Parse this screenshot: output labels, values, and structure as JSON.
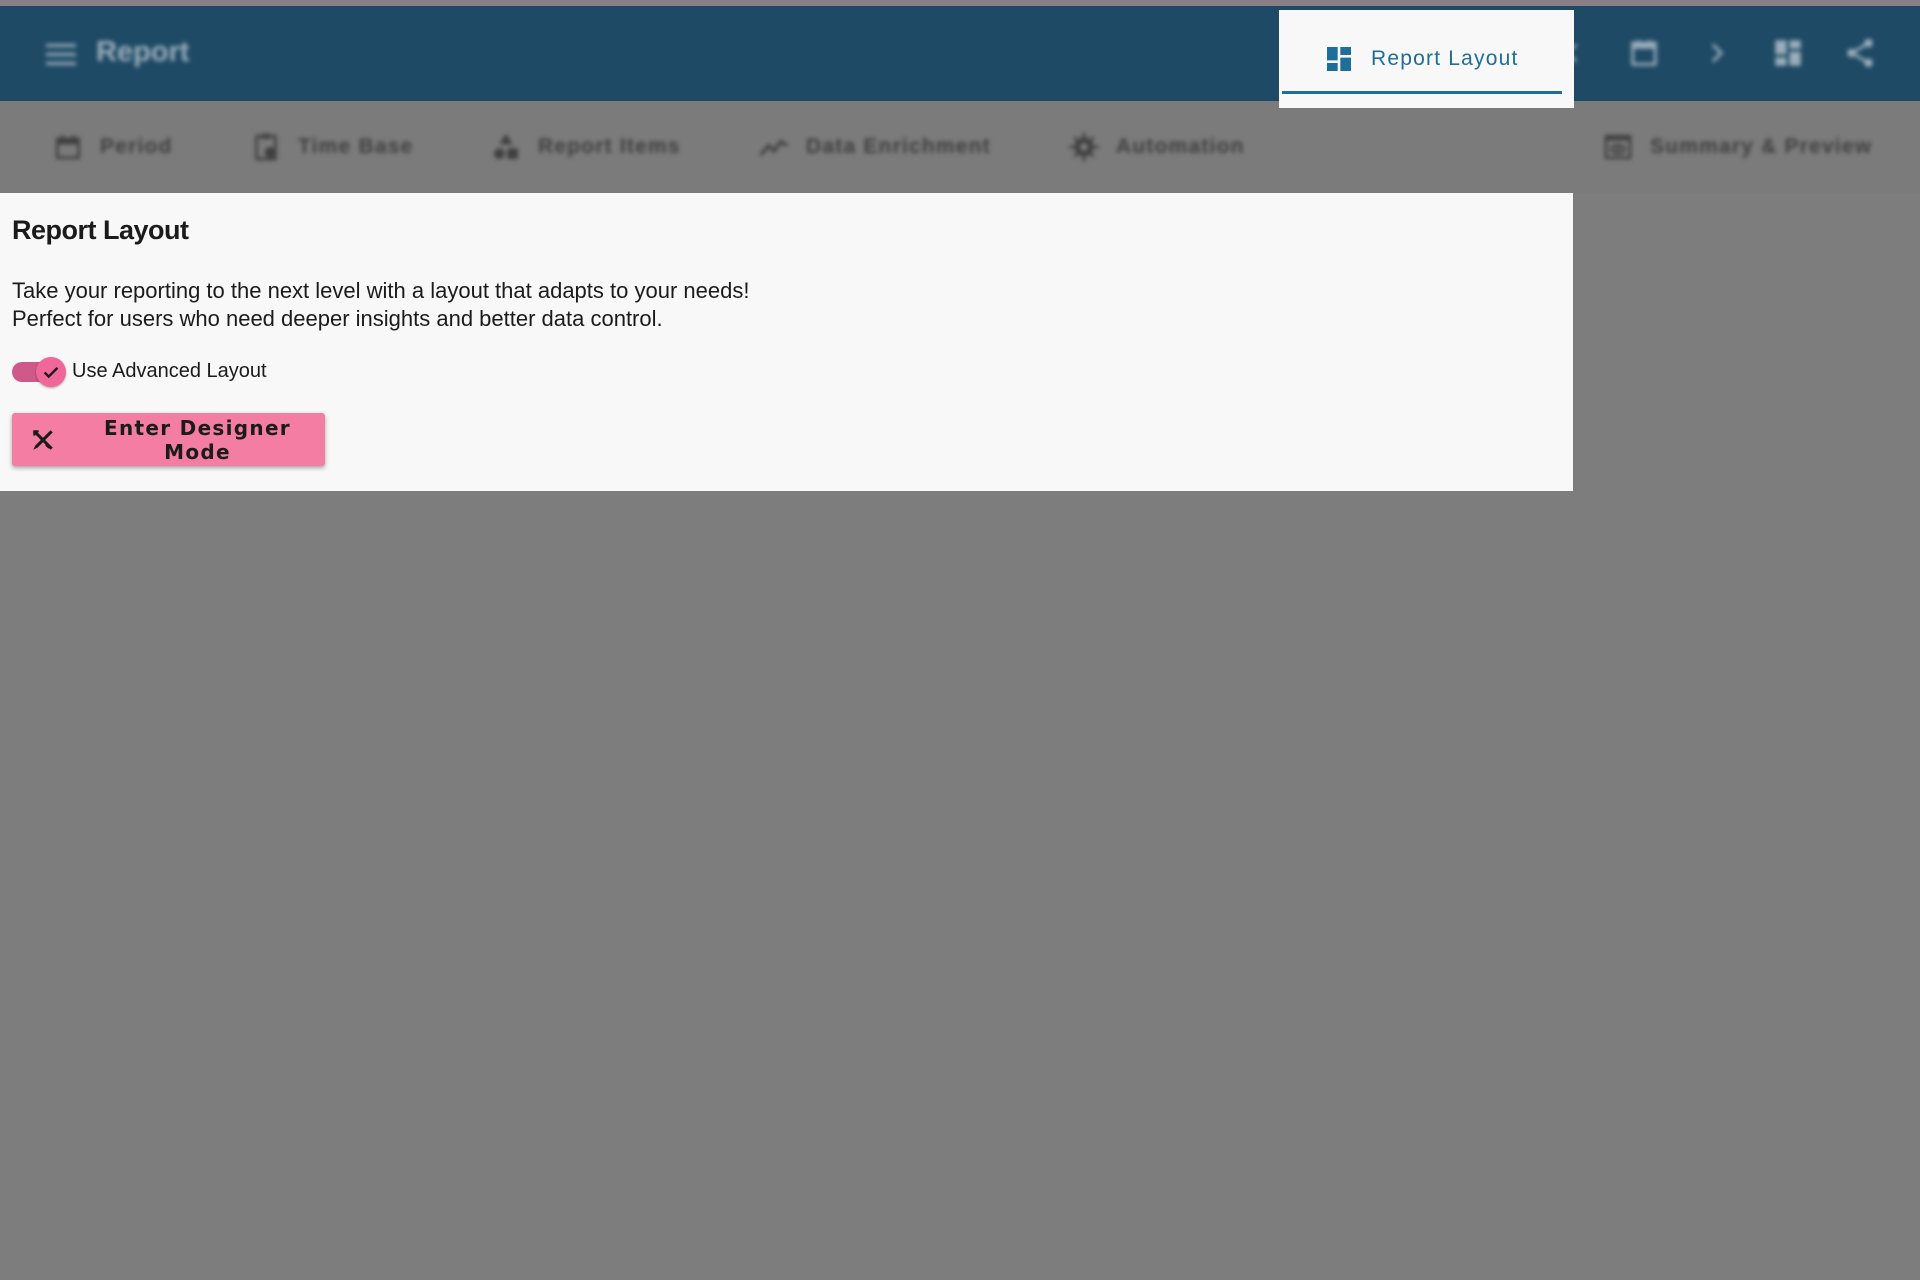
{
  "app": {
    "title": "Report",
    "actions": [
      {
        "name": "add-icon"
      },
      {
        "name": "save-icon"
      },
      {
        "name": "chevron-left-icon"
      },
      {
        "name": "calendar-icon"
      },
      {
        "name": "chevron-right-icon"
      },
      {
        "name": "dashboard-icon"
      },
      {
        "name": "share-icon"
      }
    ]
  },
  "tabs": [
    {
      "label": "Period",
      "icon": "calendar-icon"
    },
    {
      "label": "Time Base",
      "icon": "clipboard-clock-icon"
    },
    {
      "label": "Report Items",
      "icon": "shapes-icon"
    },
    {
      "label": "Data Enrichment",
      "icon": "chart-line-icon"
    },
    {
      "label": "Automation",
      "icon": "gear-icon"
    },
    {
      "label": "Report Layout",
      "icon": "dashboard-icon",
      "active": true
    },
    {
      "label": "Summary & Preview",
      "icon": "preview-icon"
    }
  ],
  "panel": {
    "title": "Report Layout",
    "description_line1": "Take your reporting to the next level with a layout that adapts to your needs!",
    "description_line2": "Perfect for users who need deeper insights and better data control.",
    "toggle_label": "Use Advanced Layout",
    "toggle_on": true,
    "designer_button_label": "Enter Designer Mode"
  },
  "colors": {
    "appbar": "#1f4a66",
    "accent": "#1f6d99",
    "button": "#f37da3",
    "toggle": "#f2679a",
    "overlay": "#7d7d7d"
  }
}
